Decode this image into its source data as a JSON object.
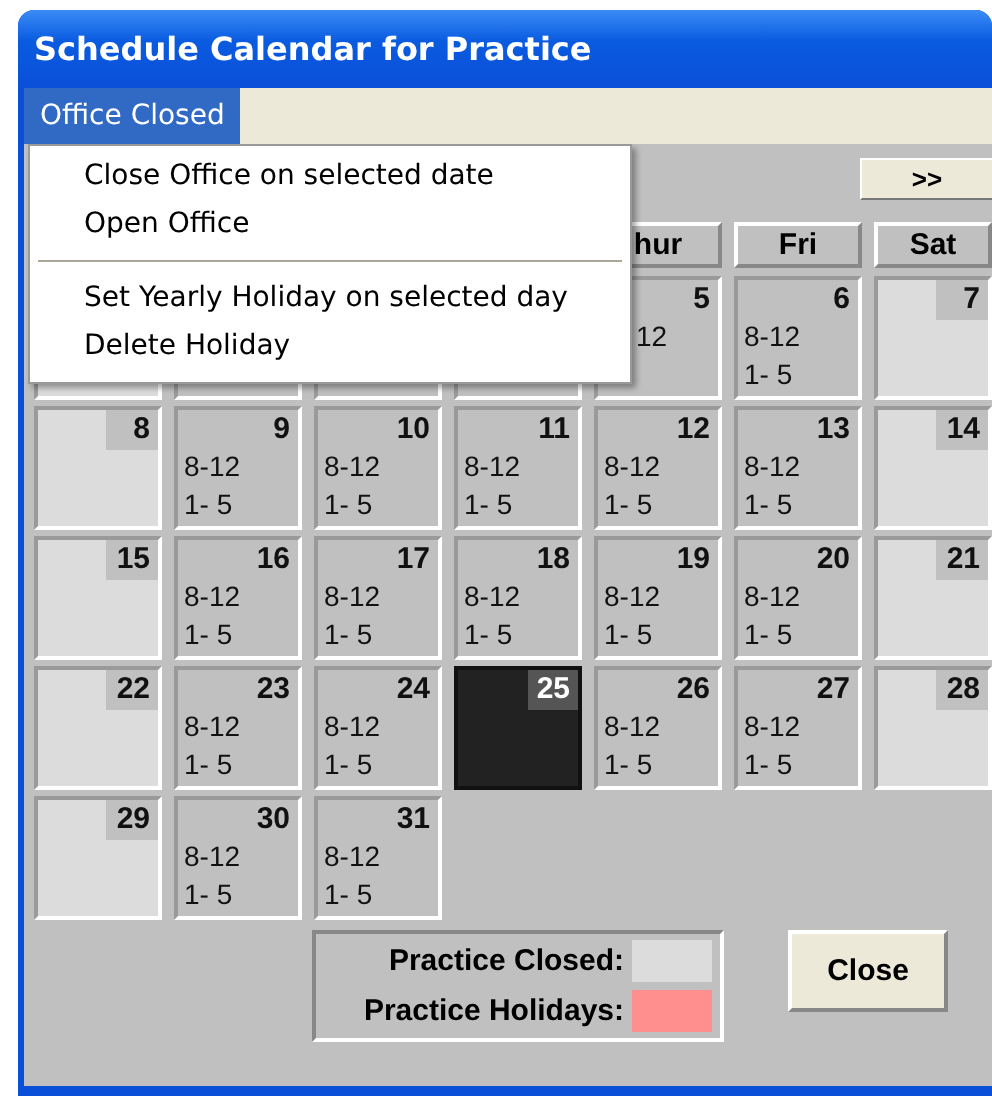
{
  "window": {
    "title": "Schedule Calendar for Practice"
  },
  "menu_bar": [
    {
      "label": "Office Closed",
      "selected": true
    }
  ],
  "dropdown": [
    {
      "kind": "command",
      "label": "Close Office on selected date"
    },
    {
      "kind": "command",
      "label": "Open Office"
    },
    {
      "kind": "separator"
    },
    {
      "kind": "command",
      "label": "Set Yearly Holiday on selected day"
    },
    {
      "kind": "command",
      "label": "Delete Holiday"
    }
  ],
  "nav": {
    "next_button": ">>"
  },
  "weekdays": [
    "hur",
    "Fri",
    "Sat"
  ],
  "weeks": [
    [
      {
        "kind": "closed",
        "selected": false
      },
      {
        "kind": "open",
        "selected": false
      },
      {
        "kind": "open",
        "selected": false
      },
      {
        "kind": "open",
        "selected": false
      },
      {
        "kind": "open",
        "day": "5",
        "hours": [
          "12"
        ],
        "partly_covered": true,
        "selected": false
      },
      {
        "kind": "open",
        "day": "6",
        "hours": [
          "8-12",
          "1- 5"
        ],
        "selected": false
      },
      {
        "kind": "closed",
        "day": "7",
        "selected": false
      }
    ],
    [
      {
        "kind": "closed",
        "day": "8",
        "selected": false
      },
      {
        "kind": "open",
        "day": "9",
        "hours": [
          "8-12",
          "1- 5"
        ],
        "selected": false
      },
      {
        "kind": "open",
        "day": "10",
        "hours": [
          "8-12",
          "1- 5"
        ],
        "selected": false
      },
      {
        "kind": "open",
        "day": "11",
        "hours": [
          "8-12",
          "1- 5"
        ],
        "selected": false
      },
      {
        "kind": "open",
        "day": "12",
        "hours": [
          "8-12",
          "1- 5"
        ],
        "selected": false
      },
      {
        "kind": "open",
        "day": "13",
        "hours": [
          "8-12",
          "1- 5"
        ],
        "selected": false
      },
      {
        "kind": "closed",
        "day": "14",
        "selected": false
      }
    ],
    [
      {
        "kind": "closed",
        "day": "15",
        "selected": false
      },
      {
        "kind": "open",
        "day": "16",
        "hours": [
          "8-12",
          "1- 5"
        ],
        "selected": false
      },
      {
        "kind": "open",
        "day": "17",
        "hours": [
          "8-12",
          "1- 5"
        ],
        "selected": false
      },
      {
        "kind": "open",
        "day": "18",
        "hours": [
          "8-12",
          "1- 5"
        ],
        "selected": false
      },
      {
        "kind": "open",
        "day": "19",
        "hours": [
          "8-12",
          "1- 5"
        ],
        "selected": false
      },
      {
        "kind": "open",
        "day": "20",
        "hours": [
          "8-12",
          "1- 5"
        ],
        "selected": false
      },
      {
        "kind": "closed",
        "day": "21",
        "selected": false
      }
    ],
    [
      {
        "kind": "closed",
        "day": "22",
        "selected": false
      },
      {
        "kind": "open",
        "day": "23",
        "hours": [
          "8-12",
          "1- 5"
        ],
        "selected": false
      },
      {
        "kind": "open",
        "day": "24",
        "hours": [
          "8-12",
          "1- 5"
        ],
        "selected": false
      },
      {
        "kind": "open",
        "day": "25",
        "selected": true
      },
      {
        "kind": "open",
        "day": "26",
        "hours": [
          "8-12",
          "1- 5"
        ],
        "selected": false
      },
      {
        "kind": "open",
        "day": "27",
        "hours": [
          "8-12",
          "1- 5"
        ],
        "selected": false
      },
      {
        "kind": "closed",
        "day": "28",
        "selected": false
      }
    ],
    [
      {
        "kind": "closed",
        "day": "29",
        "selected": false
      },
      {
        "kind": "open",
        "day": "30",
        "hours": [
          "8-12",
          "1- 5"
        ],
        "selected": false
      },
      {
        "kind": "open",
        "day": "31",
        "hours": [
          "8-12",
          "1- 5"
        ],
        "selected": false
      },
      {
        "kind": "blank"
      },
      {
        "kind": "blank"
      },
      {
        "kind": "blank"
      },
      {
        "kind": "blank"
      }
    ]
  ],
  "legend": [
    {
      "label": "Practice Closed:",
      "color": "#dcdcdc"
    },
    {
      "label": "Practice Holidays:",
      "color": "#ff8f8f"
    }
  ],
  "close_button": "Close"
}
